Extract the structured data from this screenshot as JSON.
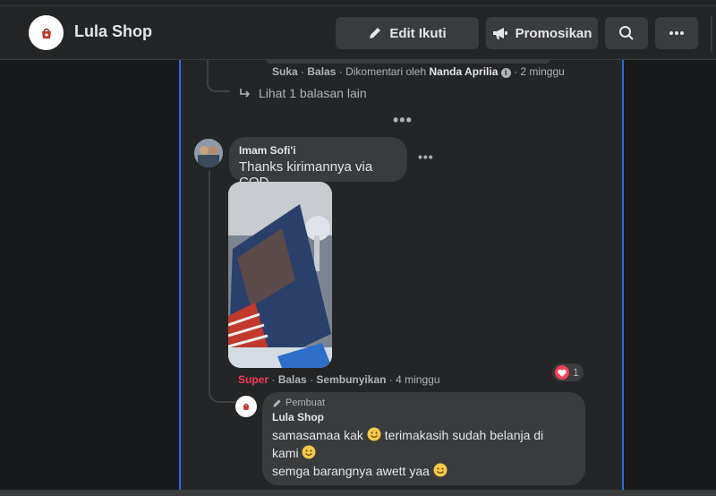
{
  "header": {
    "page_name": "Lula Shop",
    "edit_follow_label": "Edit Ikuti",
    "promote_label": "Promosikan"
  },
  "previous_comment": {
    "like_label": "Suka",
    "reply_label": "Balas",
    "commented_by_label": "Dikomentari oleh",
    "commenter": "Nanda Aprilia",
    "time": "2 minggu",
    "more_replies_label": "Lihat 1 balasan lain"
  },
  "comment": {
    "author": "Imam Sofi'i",
    "text": "Thanks kirimannya via COD",
    "reaction_label": "Super",
    "reply_label": "Balas",
    "hide_label": "Sembunyikan",
    "time": "4 minggu",
    "reaction_count": "1"
  },
  "reply": {
    "badge": "Pembuat",
    "author": "Lula Shop",
    "line1": "samasamaa kak",
    "line1b": "terimakasih sudah belanja di",
    "line2": "kami",
    "line3": "semga barangnya awett yaa"
  },
  "colors": {
    "background": "#18191a",
    "surface": "#242526",
    "bubble": "#3a3b3c",
    "accent_border": "#2d6cdf",
    "love_reaction": "#f33e58"
  },
  "icons": [
    "pencil-icon",
    "megaphone-icon",
    "search-icon",
    "more-icon",
    "reply-arrow-icon",
    "heart-icon",
    "smile-emoji-icon"
  ]
}
